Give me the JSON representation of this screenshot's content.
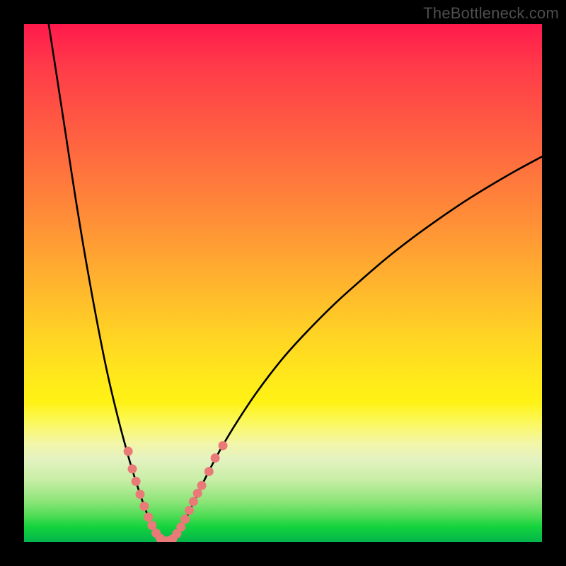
{
  "watermark": "TheBottleneck.com",
  "colors": {
    "curve_stroke": "#000000",
    "dot_fill": "#e97a77",
    "dot_stroke": "#e97a77"
  },
  "chart_data": {
    "type": "line",
    "title": "",
    "xlabel": "",
    "ylabel": "",
    "xlim": [
      0,
      100
    ],
    "ylim": [
      0,
      100
    ],
    "curve_points": [
      {
        "x": 4.6,
        "y": 101.0
      },
      {
        "x": 6.0,
        "y": 92.0
      },
      {
        "x": 8.0,
        "y": 79.0
      },
      {
        "x": 10.0,
        "y": 66.0
      },
      {
        "x": 12.0,
        "y": 54.0
      },
      {
        "x": 14.0,
        "y": 43.0
      },
      {
        "x": 16.0,
        "y": 33.0
      },
      {
        "x": 18.0,
        "y": 24.5
      },
      {
        "x": 20.0,
        "y": 17.0
      },
      {
        "x": 21.5,
        "y": 12.0
      },
      {
        "x": 23.0,
        "y": 7.5
      },
      {
        "x": 24.5,
        "y": 3.6
      },
      {
        "x": 25.5,
        "y": 1.6
      },
      {
        "x": 26.5,
        "y": 0.4
      },
      {
        "x": 27.5,
        "y": 0.0
      },
      {
        "x": 28.5,
        "y": 0.4
      },
      {
        "x": 29.5,
        "y": 1.5
      },
      {
        "x": 31.0,
        "y": 4.0
      },
      {
        "x": 33.0,
        "y": 8.2
      },
      {
        "x": 35.5,
        "y": 13.3
      },
      {
        "x": 38.0,
        "y": 18.0
      },
      {
        "x": 41.0,
        "y": 23.0
      },
      {
        "x": 45.0,
        "y": 29.0
      },
      {
        "x": 50.0,
        "y": 35.5
      },
      {
        "x": 55.0,
        "y": 41.0
      },
      {
        "x": 60.0,
        "y": 46.0
      },
      {
        "x": 65.0,
        "y": 50.5
      },
      {
        "x": 70.0,
        "y": 54.8
      },
      {
        "x": 75.0,
        "y": 58.7
      },
      {
        "x": 80.0,
        "y": 62.3
      },
      {
        "x": 85.0,
        "y": 65.7
      },
      {
        "x": 90.0,
        "y": 68.8
      },
      {
        "x": 95.0,
        "y": 71.7
      },
      {
        "x": 100.0,
        "y": 74.4
      }
    ],
    "dots": [
      {
        "x": 20.1,
        "y": 17.5
      },
      {
        "x": 20.9,
        "y": 14.1
      },
      {
        "x": 21.6,
        "y": 11.7
      },
      {
        "x": 22.4,
        "y": 9.2
      },
      {
        "x": 23.2,
        "y": 6.9
      },
      {
        "x": 24.0,
        "y": 4.8
      },
      {
        "x": 24.7,
        "y": 3.2
      },
      {
        "x": 25.5,
        "y": 1.7
      },
      {
        "x": 26.3,
        "y": 0.7
      },
      {
        "x": 27.1,
        "y": 0.2
      },
      {
        "x": 27.9,
        "y": 0.2
      },
      {
        "x": 28.7,
        "y": 0.6
      },
      {
        "x": 29.5,
        "y": 1.6
      },
      {
        "x": 30.3,
        "y": 2.9
      },
      {
        "x": 31.1,
        "y": 4.4
      },
      {
        "x": 31.9,
        "y": 6.1
      },
      {
        "x": 32.7,
        "y": 7.8
      },
      {
        "x": 33.5,
        "y": 9.4
      },
      {
        "x": 34.3,
        "y": 10.9
      },
      {
        "x": 35.7,
        "y": 13.6
      },
      {
        "x": 36.9,
        "y": 16.2
      },
      {
        "x": 38.4,
        "y": 18.6
      }
    ],
    "dot_radius_px": 6
  }
}
